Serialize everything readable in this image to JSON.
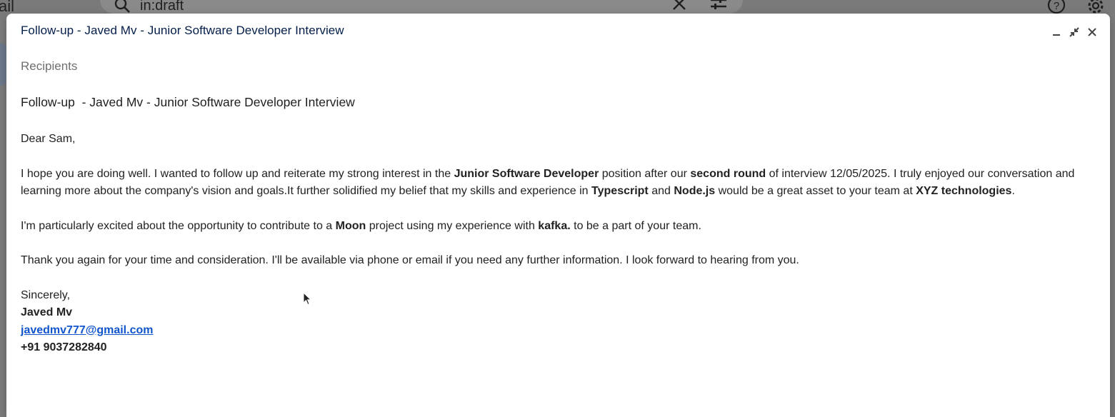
{
  "background": {
    "brand_text": "ail",
    "search_query": "in:draft"
  },
  "compose": {
    "title": "Follow-up - Javed Mv - Junior Software Developer Interview",
    "recipients_placeholder": "Recipients",
    "subject": "Follow-up  - Javed Mv - Junior Software Developer Interview",
    "controls": {
      "minimize": "minimize",
      "exit_full_screen": "exit full screen",
      "close": "close"
    }
  },
  "email_body": {
    "greeting": "Dear Sam,",
    "p1": {
      "t1": "I hope you are doing well. I wanted to follow up and reiterate my strong interest in the ",
      "b1": "Junior Software Developer",
      "t2": " position after our ",
      "b2": "second round",
      "t3": " of interview 12/05/2025. I truly enjoyed our conversation and learning more about the company's vision and goals.It further solidified my belief that my skills and experience in ",
      "b3": "Typescript",
      "t4": " and ",
      "b4": "Node.js",
      "t5": " would be a great asset to your team at ",
      "b5": "XYZ technologies",
      "t6": "."
    },
    "p2": {
      "t1": "I'm particularly excited about the opportunity to contribute to a ",
      "b1": "Moon",
      "t2": " project using my experience with ",
      "b2": "kafka.",
      "t3": " to be a part of your team."
    },
    "p3": "Thank you again for your time and consideration. I'll be available via phone or email if you need any further information. I look forward to hearing from you.",
    "signature": {
      "closing": "Sincerely,",
      "name": "Javed Mv",
      "email": "javedmv777@gmail.com",
      "phone": "+91 9037282840"
    }
  },
  "colors": {
    "title": "#041e49",
    "link": "#1155cc",
    "overlay": "#7f7f7f"
  }
}
